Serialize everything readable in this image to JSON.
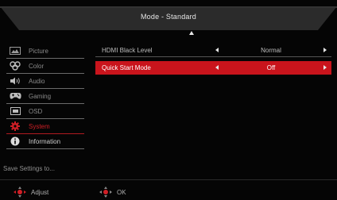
{
  "header": {
    "title": "Mode - Standard"
  },
  "sidebar": {
    "items": [
      {
        "label": "Picture",
        "icon": "picture-icon"
      },
      {
        "label": "Color",
        "icon": "color-palette-icon"
      },
      {
        "label": "Audio",
        "icon": "speaker-icon"
      },
      {
        "label": "Gaming",
        "icon": "gamepad-icon"
      },
      {
        "label": "OSD",
        "icon": "osd-window-icon"
      },
      {
        "label": "System",
        "icon": "gear-icon"
      },
      {
        "label": "Information",
        "icon": "info-icon"
      }
    ],
    "active": "System"
  },
  "main": {
    "rows": [
      {
        "label": "HDMI Black Level",
        "value": "Normal",
        "selected": false
      },
      {
        "label": "Quick Start Mode",
        "value": "Off",
        "selected": true
      }
    ]
  },
  "footer": {
    "save_label": "Save Settings to...",
    "adjust_label": "Adjust",
    "ok_label": "OK"
  },
  "colors": {
    "accent": "#c9141c",
    "active_text": "#d01f26",
    "title_bar": "#2b2b2b",
    "background": "#050505"
  }
}
